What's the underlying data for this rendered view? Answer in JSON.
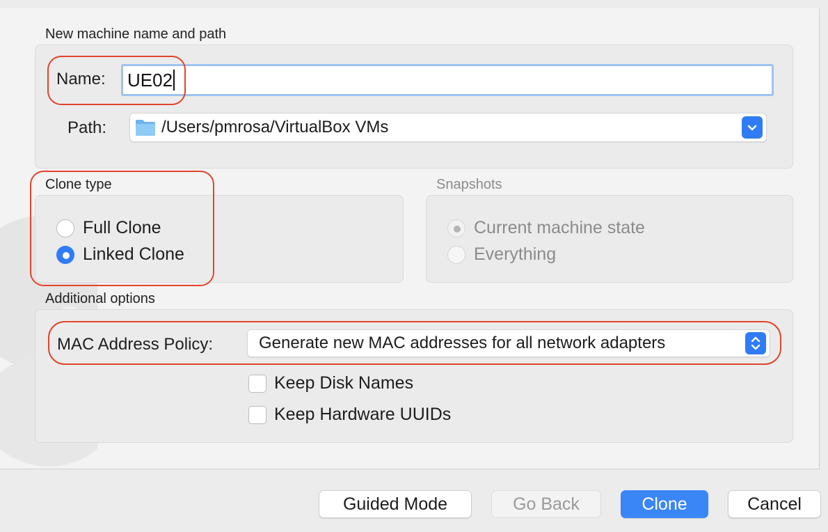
{
  "sections": {
    "machine": {
      "title": "New machine name and path"
    },
    "clone_type": {
      "title": "Clone type"
    },
    "snapshots": {
      "title": "Snapshots"
    },
    "additional": {
      "title": "Additional options"
    }
  },
  "name_field": {
    "label": "Name:",
    "value": "UE02"
  },
  "path_field": {
    "label": "Path:",
    "value": "/Users/pmrosa/VirtualBox VMs",
    "icon": "folder-icon"
  },
  "clone_type": {
    "options": [
      {
        "label": "Full Clone",
        "selected": false
      },
      {
        "label": "Linked Clone",
        "selected": true
      }
    ]
  },
  "snapshots": {
    "enabled": false,
    "options": [
      {
        "label": "Current machine state",
        "selected": true
      },
      {
        "label": "Everything",
        "selected": false
      }
    ]
  },
  "mac_policy": {
    "label": "MAC Address Policy:",
    "value": "Generate new MAC addresses for all network adapters"
  },
  "checkboxes": [
    {
      "label": "Keep Disk Names",
      "checked": false
    },
    {
      "label": "Keep Hardware UUIDs",
      "checked": false
    }
  ],
  "buttons": {
    "guided": "Guided Mode",
    "back": "Go Back",
    "clone": "Clone",
    "cancel": "Cancel"
  },
  "colors": {
    "accent": "#2f7cf6",
    "highlight": "#e0442d"
  }
}
